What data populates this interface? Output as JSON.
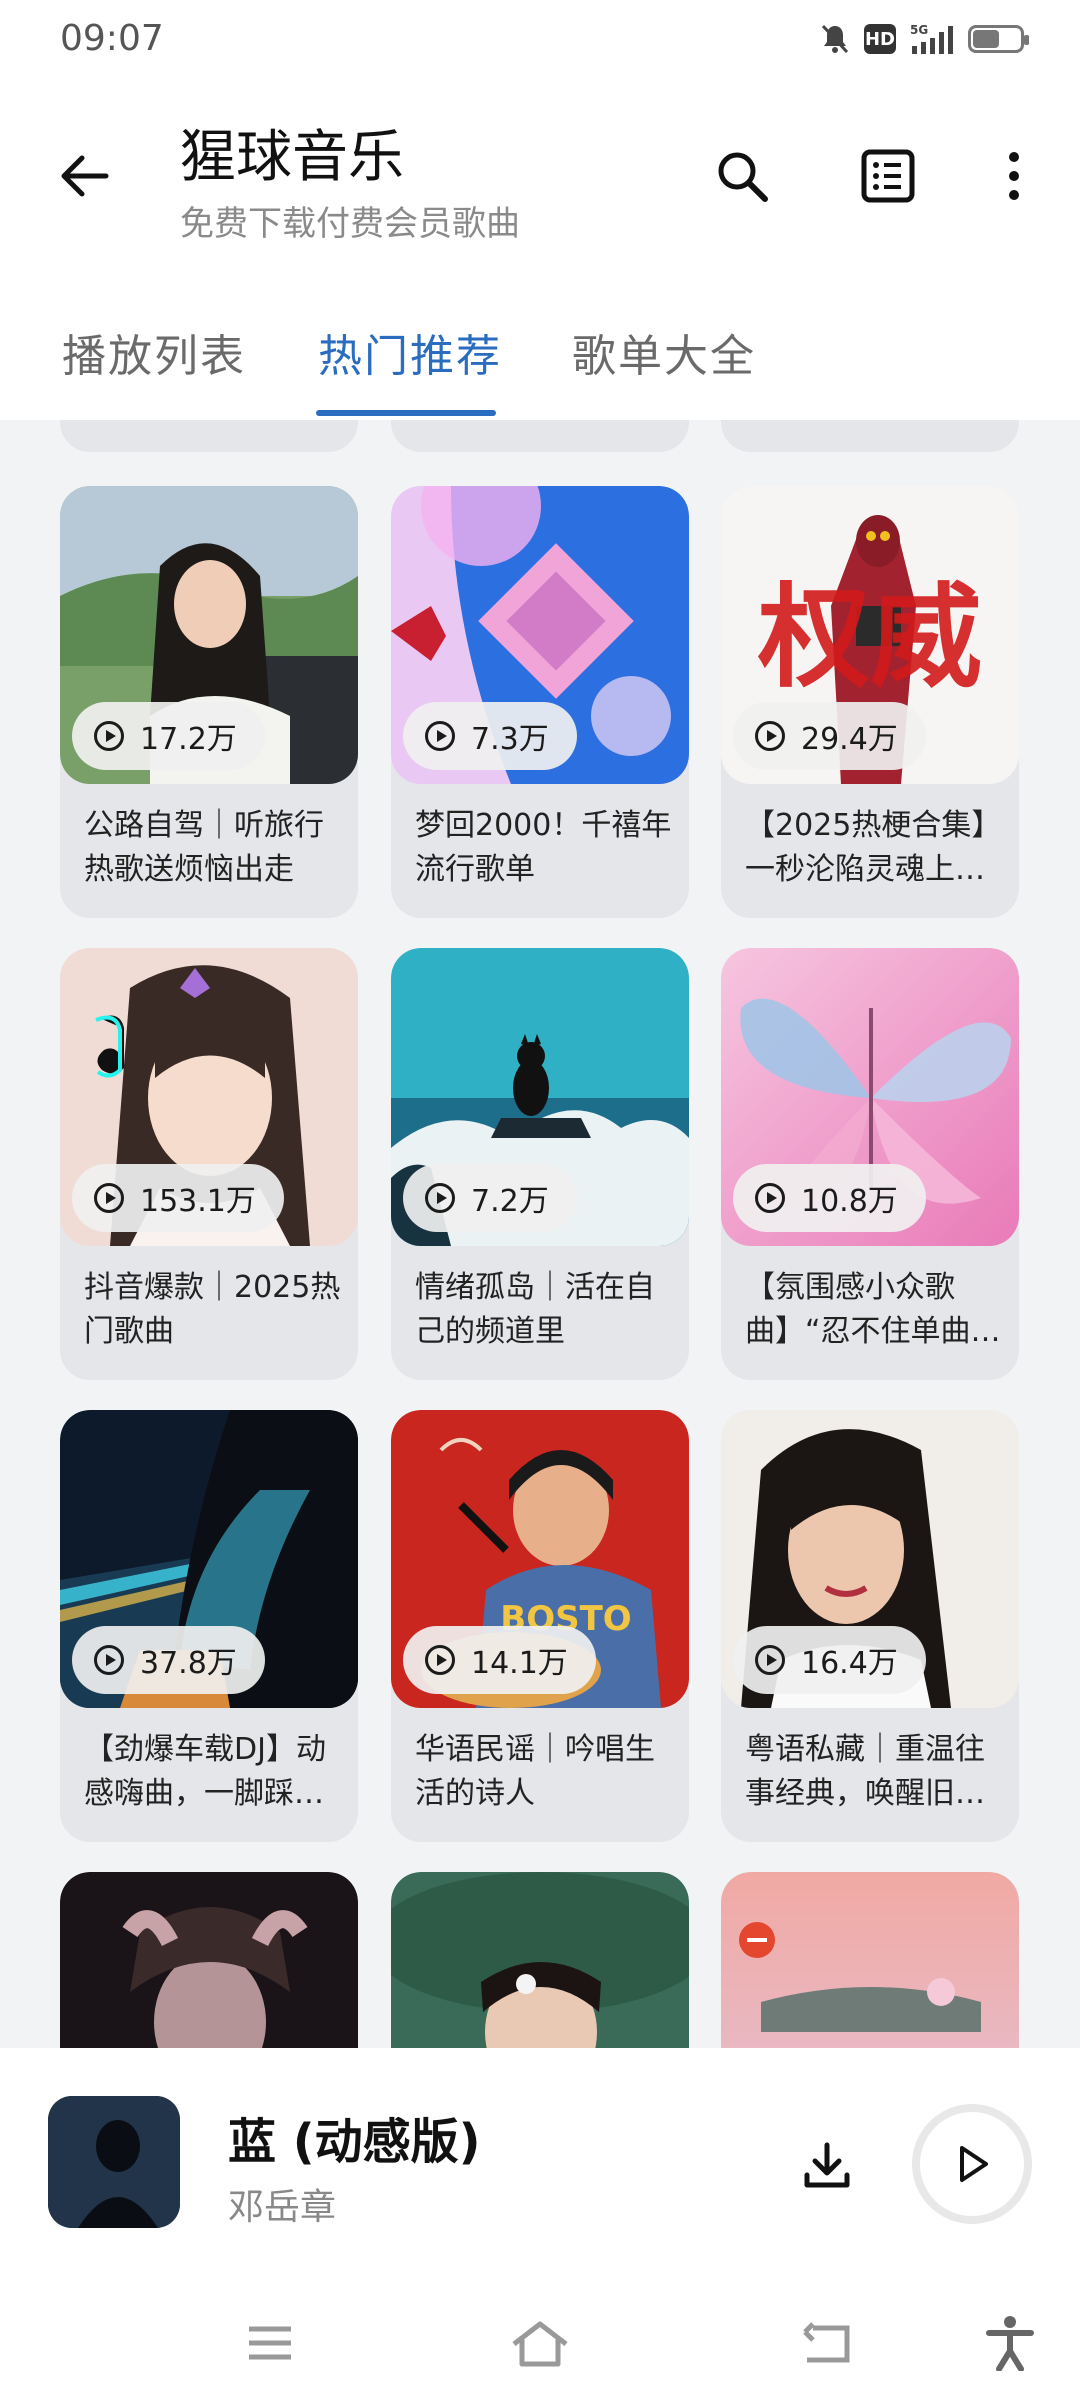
{
  "status": {
    "time": "09:07",
    "network": "5G",
    "hd": "HD"
  },
  "header": {
    "title": "猩球音乐",
    "subtitle": "免费下载付费会员歌曲"
  },
  "tabs": [
    {
      "label": "播放列表"
    },
    {
      "label": "热门推荐"
    },
    {
      "label": "歌单大全"
    }
  ],
  "playlists": [
    {
      "count": "17.2万",
      "title": "公路自驾｜听旅行热歌送烦恼出走"
    },
    {
      "count": "7.3万",
      "title": "梦回2000！千禧年流行歌单"
    },
    {
      "count": "29.4万",
      "title": "【2025热梗合集】一秒沦陷灵魂上…"
    },
    {
      "count": "153.1万",
      "title": "抖音爆款｜2025热门歌曲"
    },
    {
      "count": "7.2万",
      "title": "情绪孤岛｜活在自己的频道里"
    },
    {
      "count": "10.8万",
      "title": "【氛围感小众歌曲】“忍不住单曲…"
    },
    {
      "count": "37.8万",
      "title": "【劲爆车载DJ】动感嗨曲，一脚踩…"
    },
    {
      "count": "14.1万",
      "title": "华语民谣｜吟唱生活的诗人"
    },
    {
      "count": "16.4万",
      "title": "粤语私藏｜重温往事经典，唤醒旧…"
    }
  ],
  "cover_art_text": {
    "card3": "权威",
    "card8_shirt": "BOSTO"
  },
  "player": {
    "title": "蓝 (动感版)",
    "artist": "邓岳章"
  },
  "colors": {
    "accent": "#2a6cc0",
    "card_bg": "#e4e6e9",
    "page_bg": "#f2f3f5"
  }
}
